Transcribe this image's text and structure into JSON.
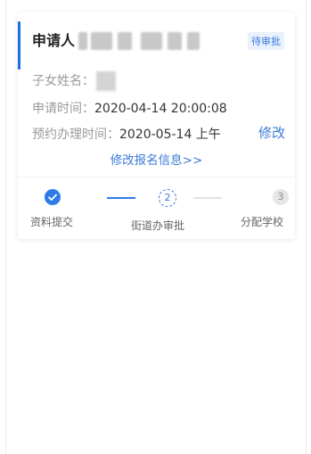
{
  "card": {
    "applicant_label": "申请人",
    "status_badge": "待审批",
    "child_name_label": "子女姓名：",
    "apply_time_label": "申请时间：",
    "apply_time_value": "2020-04-14 20:00:08",
    "appointment_label": "预约办理时间：",
    "appointment_value": "2020-05-14 上午",
    "modify_label": "修改",
    "edit_info_link": "修改报名信息>>"
  },
  "steps": [
    {
      "number": "1",
      "label": "资料提交",
      "state": "done"
    },
    {
      "number": "2",
      "label": "街道办审批",
      "state": "current"
    },
    {
      "number": "3",
      "label": "分配学校",
      "state": "pending"
    }
  ],
  "colors": {
    "accent": "#1e6fe0",
    "link": "#3d7bd6",
    "badge_bg": "#e9f1fd"
  },
  "icons": {
    "step1": "check-icon"
  }
}
